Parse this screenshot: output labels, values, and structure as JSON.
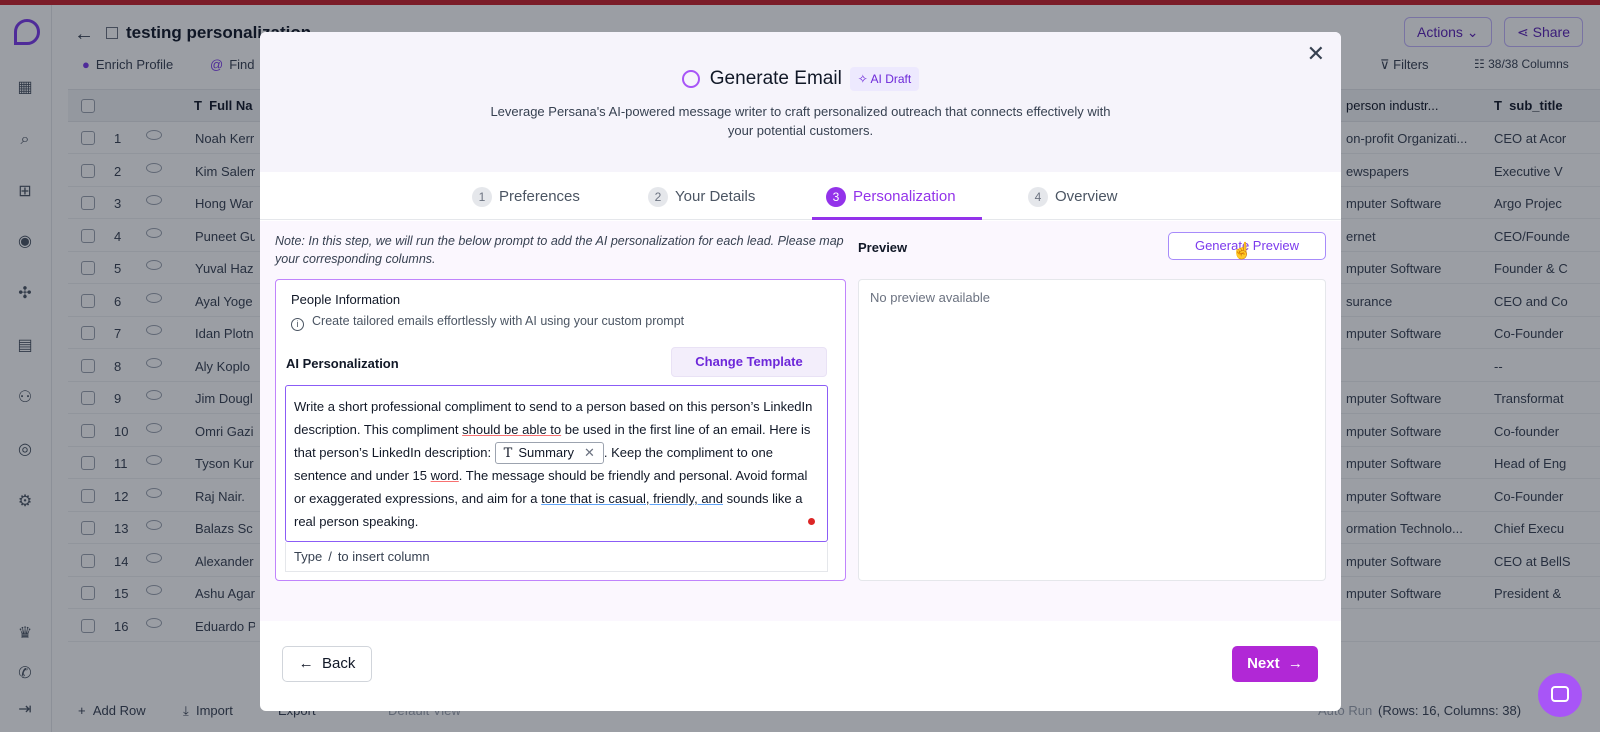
{
  "app": {
    "sheet_title": "testing personalization",
    "header_buttons": {
      "actions": "Actions",
      "share": "Share"
    },
    "toolbar": {
      "enrich": "Enrich Profile",
      "find": "Find",
      "filters": "Filters",
      "columns": "38/38 Columns"
    },
    "grid": {
      "headers": {
        "full_name": "Full Na",
        "industry": "person industr...",
        "sub_title": "sub_title"
      },
      "rows": [
        {
          "n": "1",
          "name": "Noah Kerr",
          "ind": "on-profit Organizati...",
          "sub": "CEO at Acor"
        },
        {
          "n": "2",
          "name": "Kim Salem",
          "ind": "ewspapers",
          "sub": "Executive V"
        },
        {
          "n": "3",
          "name": "Hong War",
          "ind": "mputer Software",
          "sub": "Argo Projec"
        },
        {
          "n": "4",
          "name": "Puneet Gu",
          "ind": "ernet",
          "sub": "CEO/Founde"
        },
        {
          "n": "5",
          "name": "Yuval Haz",
          "ind": "mputer Software",
          "sub": "Founder & C"
        },
        {
          "n": "6",
          "name": "Ayal Yoge",
          "ind": "surance",
          "sub": "CEO and Co"
        },
        {
          "n": "7",
          "name": "Idan Plotn",
          "ind": "mputer Software",
          "sub": "Co-Founder"
        },
        {
          "n": "8",
          "name": "Aly Koplo",
          "ind": "",
          "sub": "--"
        },
        {
          "n": "9",
          "name": "Jim Dougl",
          "ind": "mputer Software",
          "sub": "Transformat"
        },
        {
          "n": "10",
          "name": "Omri Gazi",
          "ind": "mputer Software",
          "sub": "Co-founder"
        },
        {
          "n": "11",
          "name": "Tyson Kur",
          "ind": "mputer Software",
          "sub": "Head of Eng"
        },
        {
          "n": "12",
          "name": "Raj Nair.",
          "ind": "mputer Software",
          "sub": "Co-Founder"
        },
        {
          "n": "13",
          "name": "Balazs Sc",
          "ind": "ormation Technolo...",
          "sub": "Chief Execu"
        },
        {
          "n": "14",
          "name": "Alexander",
          "ind": "mputer Software",
          "sub": "CEO at BellS"
        },
        {
          "n": "15",
          "name": "Ashu Agar",
          "ind": "mputer Software",
          "sub": "President &"
        },
        {
          "n": "16",
          "name": "Eduardo P",
          "ind": "",
          "sub": ""
        }
      ]
    },
    "footer": {
      "add_row": "Add Row",
      "import": "Import",
      "export": "Export",
      "default_view": "Default View",
      "auto_run": "Auto Run",
      "stats": "(Rows: 16, Columns: 38)"
    }
  },
  "modal": {
    "title": "Generate Email",
    "badge": "AI Draft",
    "subtitle": "Leverage Persana's AI-powered message writer to craft personalized outreach that connects effectively with your potential customers.",
    "steps": [
      {
        "num": "1",
        "label": "Preferences"
      },
      {
        "num": "2",
        "label": "Your Details"
      },
      {
        "num": "3",
        "label": "Personalization"
      },
      {
        "num": "4",
        "label": "Overview"
      }
    ],
    "note": "Note: In this step, we will run the below prompt to add the AI personalization for each lead. Please map your corresponding columns.",
    "preview_label": "Preview",
    "generate_preview": "Generate Preview",
    "people_info_title": "People Information",
    "people_info_desc": "Create tailored emails effortlessly with AI using your custom prompt",
    "ai_personalization_label": "AI Personalization",
    "change_template": "Change Template",
    "prompt": {
      "p1": "Write a short professional compliment to send to a person based on this person’s LinkedIn description. This compliment ",
      "p2": "should be able to",
      "p3": " be used in the first line of an email. Here is that person’s LinkedIn description: ",
      "chip": "Summary",
      "p4": ". Keep the compliment to one sentence and under 15 ",
      "p5": "word",
      "p6": ". The message should be friendly and personal. Avoid formal or exaggerated expressions, and aim for a ",
      "p7": "tone that is casual, friendly, and",
      "p8": " sounds like a real person speaking."
    },
    "insert_hint": {
      "before": "Type",
      "slash": "/",
      "after": "to insert column"
    },
    "preview_empty": "No preview available",
    "back": "Back",
    "next": "Next"
  },
  "colors": {
    "accent": "#9333ea",
    "next_button": "#b128d6",
    "top_accent": "#c8202a"
  }
}
